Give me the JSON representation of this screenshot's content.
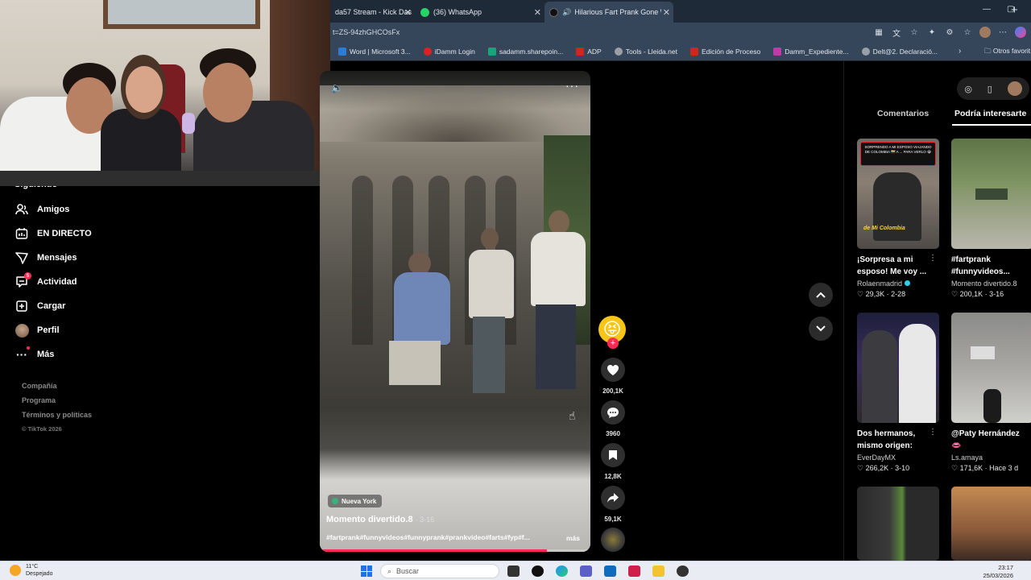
{
  "browser": {
    "tabs": [
      {
        "label": "da57 Stream - Kick Das",
        "color": "#53fc18"
      },
      {
        "label": "(36) WhatsApp",
        "color": "#25d366"
      },
      {
        "label": "Hilarious Fart Prank Gone Wr",
        "color": "#111111",
        "active": true
      }
    ],
    "url": "t=ZS-94zhGHCOsFx",
    "bookmarks": [
      {
        "label": "Word | Microsoft 3...",
        "color": "#2b7cd3"
      },
      {
        "label": "iDamm Login",
        "color": "#e02020"
      },
      {
        "label": "sadamm.sharepoin...",
        "color": "#1aa37a"
      },
      {
        "label": "ADP",
        "color": "#d0271d"
      },
      {
        "label": "Tools - Lleida.net",
        "color": "#9aa0a6"
      },
      {
        "label": "Edición de Proceso",
        "color": "#d0271d"
      },
      {
        "label": "Damm_Expediente...",
        "color": "#c03aa8"
      },
      {
        "label": "Delt@2. Declaració...",
        "color": "#9aa0a6"
      }
    ],
    "bookmarks_folder": "Otros favorit"
  },
  "sidebar": {
    "cut_item": "Siguiendo",
    "items": [
      {
        "label": "Amigos",
        "icon": "friends-icon"
      },
      {
        "label": "EN DIRECTO",
        "icon": "live-icon"
      },
      {
        "label": "Mensajes",
        "icon": "messages-icon"
      },
      {
        "label": "Actividad",
        "icon": "activity-icon",
        "badge": "5"
      },
      {
        "label": "Cargar",
        "icon": "upload-icon"
      },
      {
        "label": "Perfil",
        "icon": "profile-avatar"
      },
      {
        "label": "Más",
        "icon": "more-icon"
      }
    ],
    "footer": [
      "Compañía",
      "Programa",
      "Términos y políticas"
    ],
    "copyright": "© TikTok 2026"
  },
  "video": {
    "location": "Nueva York",
    "author": "Momento divertido.8",
    "date": "· 3-16",
    "tags": "#fartprank#funnyvideos#funnyprank#prankvideo#farts#fyp#f...",
    "more": "más",
    "progress": 0.84
  },
  "actions": {
    "likes": "200,1K",
    "comments": "3960",
    "saves": "12,8K",
    "shares": "59,1K"
  },
  "right_panel": {
    "tabs": [
      "Comentarios",
      "Podría interesarte"
    ],
    "cards": [
      {
        "title": "¡Sorpresa a mi esposo! Me voy ...",
        "author": "Rolaenmadrid",
        "verified": true,
        "likes": "29,3K",
        "date": "2-28",
        "thumb_text": "SORPRENDO A MI ESPOSO VIAJANDO DE COLOMBIA 🇨🇴 A ... PARA VERLO 😭",
        "thumb_caption": "de Mi Colombia"
      },
      {
        "title": "#fartprank #funnyvideos...",
        "author": "Momento divertido.8",
        "verified": false,
        "likes": "200,1K",
        "date": "3-16"
      },
      {
        "title": "Dos hermanos, mismo origen: un...",
        "author": "EverDayMX",
        "verified": false,
        "likes": "266,2K",
        "date": "3-10"
      },
      {
        "title": "@Paty Hernández 👄",
        "author": "Ls.amaya",
        "verified": false,
        "likes": "171,6K",
        "date": "Hace 3 d"
      }
    ]
  },
  "taskbar": {
    "temperature": "11°C",
    "weather": "Despejado",
    "search": "Buscar",
    "time": "23:17",
    "date": "25/03/2026"
  }
}
